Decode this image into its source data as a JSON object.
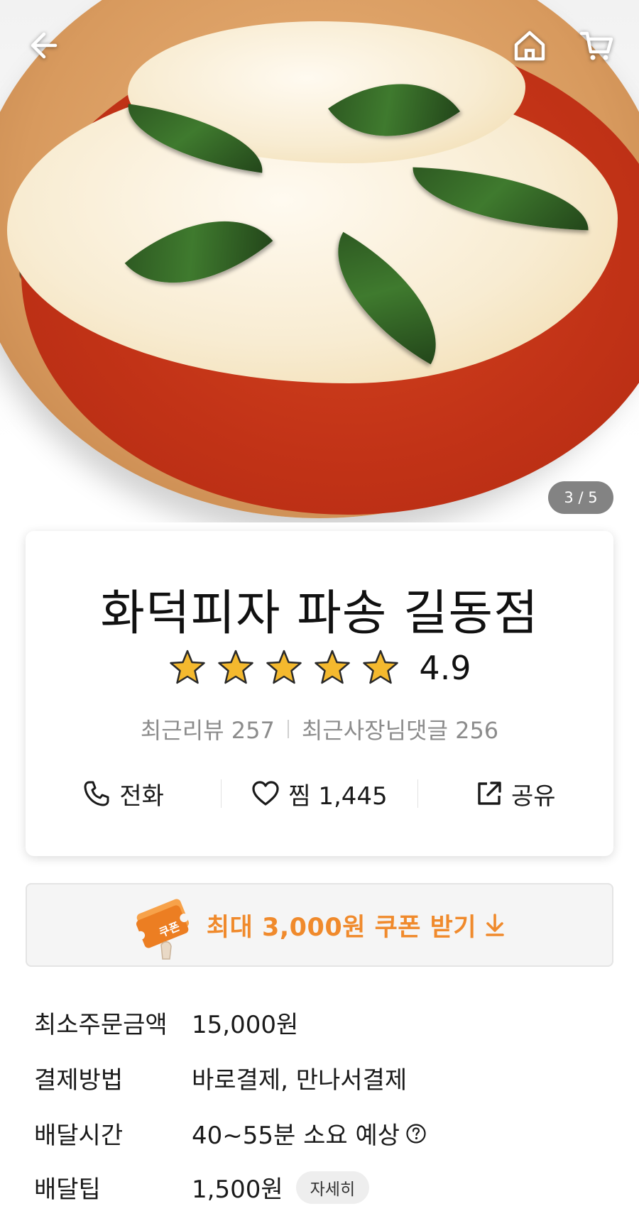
{
  "hero": {
    "image_counter": "3 / 5",
    "icons": [
      "back-arrow-icon",
      "home-icon",
      "cart-icon"
    ]
  },
  "store": {
    "name": "화덕피자 파송 길동점",
    "rating": "4.9",
    "rating_stars": 5,
    "reviews_text": "최근리뷰 257",
    "owner_replies_text": "최근사장님댓글 256"
  },
  "actions": {
    "call_label": "전화",
    "favorite_label": "찜 1,445",
    "share_label": "공유"
  },
  "coupon": {
    "icon_text": "쿠폰",
    "label": "최대 3,000원 쿠폰 받기",
    "accent_color": "#f08a2c"
  },
  "details": [
    {
      "label": "최소주문금액",
      "value": "15,000원"
    },
    {
      "label": "결제방법",
      "value": "바로결제, 만나서결제"
    },
    {
      "label": "배달시간",
      "value": "40~55분 소요 예상"
    },
    {
      "label": "배달팁",
      "value": "1,500원",
      "badge": "자세히"
    }
  ]
}
